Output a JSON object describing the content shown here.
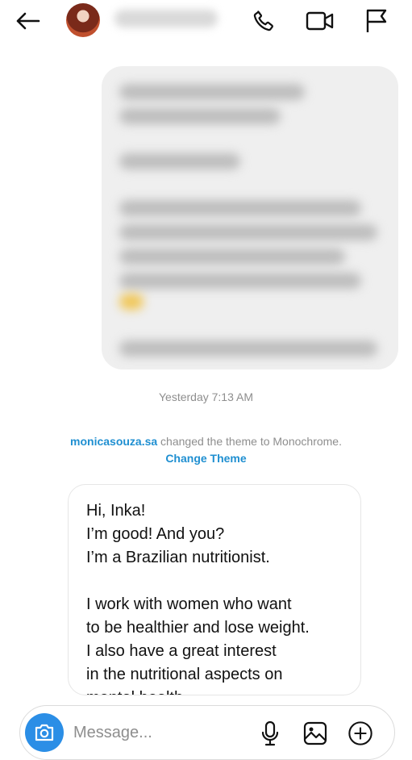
{
  "header": {
    "back_icon": "arrow-left-icon",
    "call_icon": "phone-icon",
    "video_icon": "video-camera-icon",
    "report_icon": "flag-icon"
  },
  "conversation": {
    "timestamp": "Yesterday 7:13 AM",
    "theme_change": {
      "username": "monicasouza.sa",
      "text": " changed the theme to Monochrome.",
      "action_label": "Change Theme"
    },
    "sent_message": {
      "lines": [
        "Hi, Inka!",
        "I’m good! And you?",
        "I’m a Brazilian nutritionist.",
        "",
        "I work with women who want",
        "to be healthier and lose weight.",
        "I also have a great interest",
        "in the nutritional aspects on",
        "mental health"
      ]
    }
  },
  "composer": {
    "placeholder": "Message...",
    "camera_icon": "camera-icon",
    "mic_icon": "microphone-icon",
    "gallery_icon": "image-icon",
    "add_icon": "plus-circle-icon"
  },
  "colors": {
    "accent": "#1f8fd1",
    "camera_button": "#2b8ee6",
    "received_bubble": "#efefef",
    "muted_text": "#8e8e8e"
  }
}
